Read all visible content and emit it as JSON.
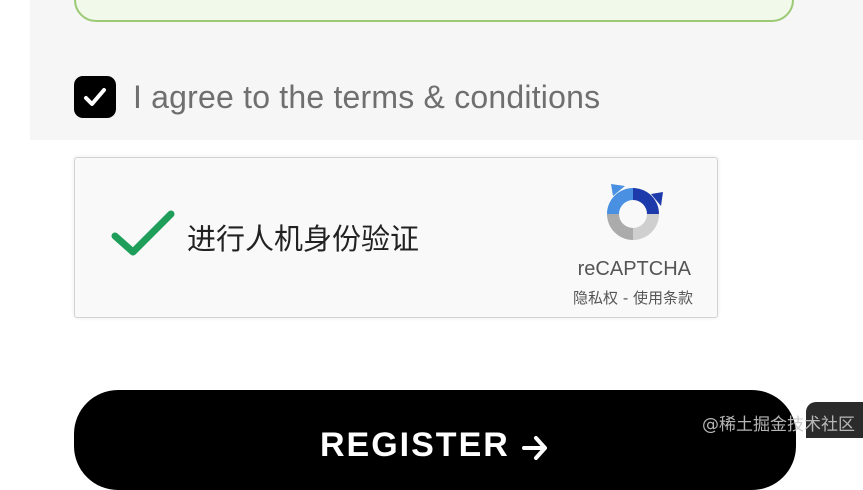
{
  "terms": {
    "label": "I agree to the terms & conditions",
    "checked": true
  },
  "recaptcha": {
    "label": "进行人机身份验证",
    "brand": "reCAPTCHA",
    "links": "隐私权 - 使用条款",
    "status": "verified",
    "check_color": "#1e9e5a"
  },
  "register": {
    "label": "REGISTER"
  },
  "watermark": {
    "text": "@稀土掘金技术社区"
  },
  "icons": {
    "checkbox": "check-icon",
    "recaptcha_check": "checkmark-icon",
    "recaptcha_logo": "recaptcha-logo-icon",
    "register_arrow": "arrow-right-icon"
  }
}
